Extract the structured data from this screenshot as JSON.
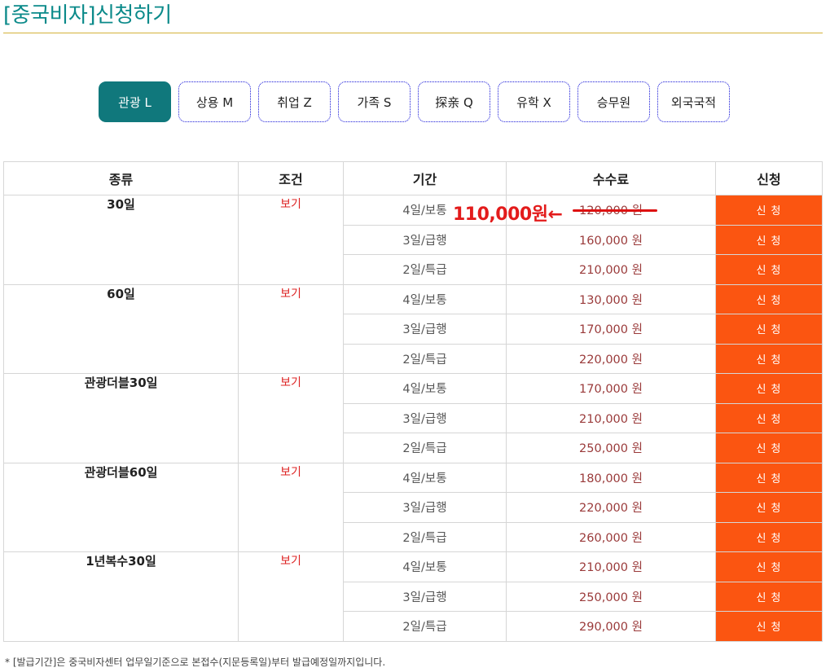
{
  "page": {
    "title": "[중국비자]신청하기"
  },
  "tabs": [
    {
      "label": "관광 L",
      "active": true
    },
    {
      "label": "상용 M",
      "active": false
    },
    {
      "label": "취업 Z",
      "active": false
    },
    {
      "label": "가족 S",
      "active": false
    },
    {
      "label": "探亲 Q",
      "active": false
    },
    {
      "label": "유학 X",
      "active": false
    },
    {
      "label": "승무원",
      "active": false
    },
    {
      "label": "외국국적",
      "active": false
    }
  ],
  "table": {
    "headers": {
      "kind": "종류",
      "condition": "조건",
      "period": "기간",
      "fee": "수수료",
      "apply": "신청"
    },
    "groups": [
      {
        "kind": "30일",
        "condition": "보기",
        "rows": [
          {
            "period": "4일/보통",
            "fee": "120,000 원",
            "apply": "신 청"
          },
          {
            "period": "3일/급행",
            "fee": "160,000 원",
            "apply": "신 청"
          },
          {
            "period": "2일/특급",
            "fee": "210,000 원",
            "apply": "신 청"
          }
        ]
      },
      {
        "kind": "60일",
        "condition": "보기",
        "rows": [
          {
            "period": "4일/보통",
            "fee": "130,000 원",
            "apply": "신 청"
          },
          {
            "period": "3일/급행",
            "fee": "170,000 원",
            "apply": "신 청"
          },
          {
            "period": "2일/특급",
            "fee": "220,000 원",
            "apply": "신 청"
          }
        ]
      },
      {
        "kind": "관광더블30일",
        "condition": "보기",
        "rows": [
          {
            "period": "4일/보통",
            "fee": "170,000 원",
            "apply": "신 청"
          },
          {
            "period": "3일/급행",
            "fee": "210,000 원",
            "apply": "신 청"
          },
          {
            "period": "2일/특급",
            "fee": "250,000 원",
            "apply": "신 청"
          }
        ]
      },
      {
        "kind": "관광더블60일",
        "condition": "보기",
        "rows": [
          {
            "period": "4일/보통",
            "fee": "180,000 원",
            "apply": "신 청"
          },
          {
            "period": "3일/급행",
            "fee": "220,000 원",
            "apply": "신 청"
          },
          {
            "period": "2일/특급",
            "fee": "260,000 원",
            "apply": "신 청"
          }
        ]
      },
      {
        "kind": "1년복수30일",
        "condition": "보기",
        "rows": [
          {
            "period": "4일/보통",
            "fee": "210,000 원",
            "apply": "신 청"
          },
          {
            "period": "3일/급행",
            "fee": "250,000 원",
            "apply": "신 청"
          },
          {
            "period": "2일/특급",
            "fee": "290,000 원",
            "apply": "신 청"
          }
        ]
      }
    ]
  },
  "promo": {
    "sale_price": "110,000원←"
  },
  "footnote": "* [발급기간]은 중국비자센터 업무일기준으로 본접수(지문등록일)부터 발급예정일까지입니다.",
  "colors": {
    "accent": "#10787c",
    "apply_button": "#fb5511",
    "sale": "#e31b1b",
    "title": "#0b8a8a"
  }
}
